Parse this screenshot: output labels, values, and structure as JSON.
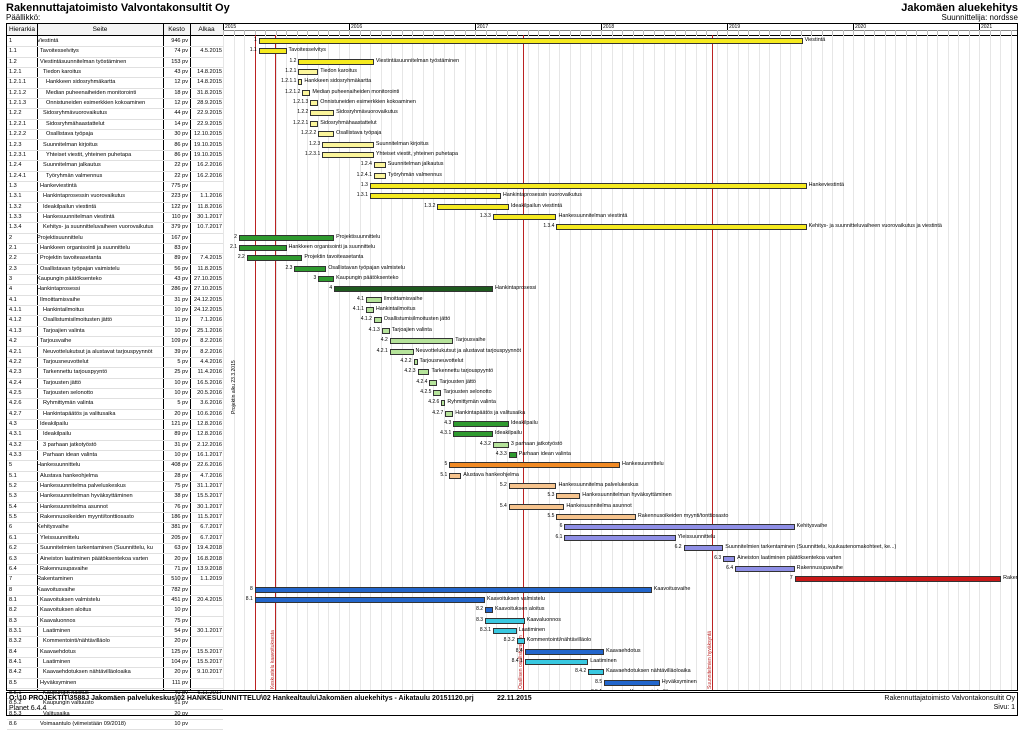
{
  "header": {
    "company": "Rakennuttajatoimisto Valvontakonsultit Oy",
    "manager": "Päällikkö:",
    "project": "Jakomäen aluekehitys",
    "designer": "Suunnittelija: nordsse"
  },
  "columns": {
    "id": "Hierarkia",
    "name": "Seite",
    "duration": "Kesto",
    "start": "Alkaa"
  },
  "timeline": {
    "years": [
      "2015",
      "2016",
      "2017",
      "2018",
      "2019",
      "2020",
      "2021"
    ],
    "milestone_texts": [
      "Projektin alku 23.3.2015",
      "Keskustelu kaavoituksesta",
      "Osallisen osallistuminen",
      "Suunnitelmien hyväksyntä"
    ]
  },
  "colors": {
    "yellow": "#f5ea1f",
    "green": "#2f9a2f",
    "darkgreen": "#1f5a1f",
    "orange": "#f08a24",
    "lightorange": "#f6c48e",
    "purple": "#8f8fe6",
    "red": "#c81818",
    "blue": "#2266cc",
    "cyan": "#38c8e0",
    "lightyellow": "#fbf59a",
    "lightgreen": "#b5e39a"
  },
  "tasks": [
    {
      "id": "1",
      "name": "Viestintä",
      "dur": "946 pv",
      "start": "",
      "bar": [
        0.045,
        0.73
      ],
      "color": "yellow",
      "label": "Viestintä"
    },
    {
      "id": "1.1",
      "name": "Tavoitesselvitys",
      "dur": "74 pv",
      "start": "4.5.2015",
      "bar": [
        0.045,
        0.08
      ],
      "color": "yellow",
      "label": "Tavoitesselvitys"
    },
    {
      "id": "1.2",
      "name": "Viestintäsuunnitelman työstäminen",
      "dur": "153 pv",
      "start": "",
      "bar": [
        0.095,
        0.19
      ],
      "color": "yellow",
      "label": "Viestintäsuunnitelman työstäminen"
    },
    {
      "id": "1.2.1",
      "name": "Tiedon karoitus",
      "dur": "43 pv",
      "start": "14.8.2015",
      "bar": [
        0.095,
        0.12
      ],
      "color": "lightyellow",
      "label": "Tiedon karoitus"
    },
    {
      "id": "1.2.1.1",
      "name": "Hankkeen sidosryhmäkartta",
      "dur": "12 pv",
      "start": "14.8.2015",
      "bar": [
        0.095,
        0.1
      ],
      "color": "lightyellow",
      "label": "Hankkeen sidosryhmäkartta"
    },
    {
      "id": "1.2.1.2",
      "name": "Median puheenaiheiden monitorointi",
      "dur": "18 pv",
      "start": "31.8.2015",
      "bar": [
        0.1,
        0.11
      ],
      "color": "lightyellow",
      "label": "Median puheenaiheiden monitorointi"
    },
    {
      "id": "1.2.1.3",
      "name": "Onnistuneiden esimerkkien kokoaminen",
      "dur": "12 pv",
      "start": "28.9.2015",
      "bar": [
        0.11,
        0.12
      ],
      "color": "lightyellow",
      "label": "Onnistuneiden esimerkkien kokoaminen"
    },
    {
      "id": "1.2.2",
      "name": "Sidosryhmävuorovaikutus",
      "dur": "44 pv",
      "start": "22.9.2015",
      "bar": [
        0.11,
        0.14
      ],
      "color": "lightyellow",
      "label": "Sidosryhmävuorovaikutus"
    },
    {
      "id": "1.2.2.1",
      "name": "Sidosryhmähaastattelut",
      "dur": "14 pv",
      "start": "22.9.2015",
      "bar": [
        0.11,
        0.12
      ],
      "color": "lightyellow",
      "label": "Sidosryhmähaastattelut"
    },
    {
      "id": "1.2.2.2",
      "name": "Osallistava työpaja",
      "dur": "30 pv",
      "start": "12.10.2015",
      "bar": [
        0.12,
        0.14
      ],
      "color": "lightyellow",
      "label": "Osallistava työpaja"
    },
    {
      "id": "1.2.3",
      "name": "Suunnitelman kirjoitus",
      "dur": "86 pv",
      "start": "19.10.2015",
      "bar": [
        0.125,
        0.19
      ],
      "color": "lightyellow",
      "label": "Suunnitelman kirjoitus"
    },
    {
      "id": "1.2.3.1",
      "name": "Yhteiset viestit, yhteinen puhetapa",
      "dur": "86 pv",
      "start": "19.10.2015",
      "bar": [
        0.125,
        0.19
      ],
      "color": "lightyellow",
      "label": "Yhteiset viestit, yhteinen puhetapa"
    },
    {
      "id": "1.2.4",
      "name": "Suunnitelman jalkautus",
      "dur": "22 pv",
      "start": "16.2.2016",
      "bar": [
        0.19,
        0.205
      ],
      "color": "lightyellow",
      "label": "Suunnitelman jalkautus"
    },
    {
      "id": "1.2.4.1",
      "name": "Työryhmän valmennus",
      "dur": "22 pv",
      "start": "16.2.2016",
      "bar": [
        0.19,
        0.205
      ],
      "color": "lightyellow",
      "label": "Työryhmän valmennus"
    },
    {
      "id": "1.3",
      "name": "Hankeviestintä",
      "dur": "775 pv",
      "start": "",
      "bar": [
        0.185,
        0.735
      ],
      "color": "yellow",
      "label": "Hankeviestintä"
    },
    {
      "id": "1.3.1",
      "name": "Hankintaprosessin vuorovaikutus",
      "dur": "223 pv",
      "start": "1.1.2016",
      "bar": [
        0.185,
        0.35
      ],
      "color": "yellow",
      "label": "Hankintaprosessin vuorovaikutus"
    },
    {
      "id": "1.3.2",
      "name": "Ideakilpailun viestintä",
      "dur": "122 pv",
      "start": "11.8.2016",
      "bar": [
        0.27,
        0.36
      ],
      "color": "yellow",
      "label": "Ideakilpailun viestintä"
    },
    {
      "id": "1.3.3",
      "name": "Hankesuunnitelman viestintä",
      "dur": "110 pv",
      "start": "30.1.2017",
      "bar": [
        0.34,
        0.42
      ],
      "color": "yellow",
      "label": "Hankesuunnitelman viestintä"
    },
    {
      "id": "1.3.4",
      "name": "Kehitys- ja suunnitteluvaiheen vuorovaikutus",
      "dur": "379 pv",
      "start": "10.7.2017",
      "bar": [
        0.42,
        0.735
      ],
      "color": "yellow",
      "label": "Kehitys- ja suunnitteluvaiheen vuorovaikutus ja viestintä"
    },
    {
      "id": "2",
      "name": "Projektisuunnittelu",
      "dur": "167 pv",
      "start": "",
      "bar": [
        0.02,
        0.14
      ],
      "color": "green",
      "label": "Projektisuunnittelu"
    },
    {
      "id": "2.1",
      "name": "Hankkeen organisointi ja suunnittelu",
      "dur": "83 pv",
      "start": "",
      "bar": [
        0.02,
        0.08
      ],
      "color": "green",
      "label": "Hankkeen organisointi ja suunnittelu"
    },
    {
      "id": "2.2",
      "name": "Projektin tavoiteasetanta",
      "dur": "89 pv",
      "start": "7.4.2015",
      "bar": [
        0.03,
        0.1
      ],
      "color": "green",
      "label": "Projektin tavoiteasetanta"
    },
    {
      "id": "2.3",
      "name": "Osallistavan työpajan vaimistelu",
      "dur": "56 pv",
      "start": "11.8.2015",
      "bar": [
        0.09,
        0.13
      ],
      "color": "green",
      "label": "Osallistavan työpajan valmistelu"
    },
    {
      "id": "3",
      "name": "Kaupungin päätöksenteko",
      "dur": "43 pv",
      "start": "27.10.2015",
      "bar": [
        0.12,
        0.14
      ],
      "color": "green",
      "label": "Kaupungin päätöksenteko"
    },
    {
      "id": "4",
      "name": "Hankintaprosessi",
      "dur": "286 pv",
      "start": "27.10.2015",
      "bar": [
        0.14,
        0.34
      ],
      "color": "darkgreen",
      "label": "Hankintaprosessi"
    },
    {
      "id": "4.1",
      "name": "Ilmoittamisvaihe",
      "dur": "31 pv",
      "start": "24.12.2015",
      "bar": [
        0.18,
        0.2
      ],
      "color": "lightgreen",
      "label": "Ilmoittamisvaihe"
    },
    {
      "id": "4.1.1",
      "name": "Hankintailmoitus",
      "dur": "10 pv",
      "start": "24.12.2015",
      "bar": [
        0.18,
        0.19
      ],
      "color": "lightgreen",
      "label": "Hankintailmoitus"
    },
    {
      "id": "4.1.2",
      "name": "Osallistumisilmoitusten jättö",
      "dur": "11 pv",
      "start": "7.1.2016",
      "bar": [
        0.19,
        0.2
      ],
      "color": "lightgreen",
      "label": "Osallistumisilmoitusten jättö"
    },
    {
      "id": "4.1.3",
      "name": "Tarjoajien valinta",
      "dur": "10 pv",
      "start": "25.1.2016",
      "bar": [
        0.2,
        0.21
      ],
      "color": "lightgreen",
      "label": "Tarjoajien valinta"
    },
    {
      "id": "4.2",
      "name": "Tarjousvaihe",
      "dur": "109 pv",
      "start": "8.2.2016",
      "bar": [
        0.21,
        0.29
      ],
      "color": "lightgreen",
      "label": "Tarjousvaihe"
    },
    {
      "id": "4.2.1",
      "name": "Neuvottelukutsut ja alustavat tarjouspyynnöt",
      "dur": "39 pv",
      "start": "8.2.2016",
      "bar": [
        0.21,
        0.24
      ],
      "color": "lightgreen",
      "label": "Neuvottelukutsut ja alustavat tarjouspyynnöt"
    },
    {
      "id": "4.2.2",
      "name": "Tarjousneuvottelut",
      "dur": "5 pv",
      "start": "4.4.2016",
      "bar": [
        0.24,
        0.245
      ],
      "color": "lightgreen",
      "label": "Tarjousneuvottelut"
    },
    {
      "id": "4.2.3",
      "name": "Tarkennettu tarjouspyyntö",
      "dur": "25 pv",
      "start": "11.4.2016",
      "bar": [
        0.245,
        0.26
      ],
      "color": "lightgreen",
      "label": "Tarkennettu tarjouspyyntö"
    },
    {
      "id": "4.2.4",
      "name": "Tarjousten jättö",
      "dur": "10 pv",
      "start": "16.5.2016",
      "bar": [
        0.26,
        0.27
      ],
      "color": "lightgreen",
      "label": "Tarjousten jättö"
    },
    {
      "id": "4.2.5",
      "name": "Tarjousten selonotto",
      "dur": "10 pv",
      "start": "20.5.2016",
      "bar": [
        0.265,
        0.275
      ],
      "color": "lightgreen",
      "label": "Tarjousten selonotto"
    },
    {
      "id": "4.2.6",
      "name": "Ryhmittymän valinta",
      "dur": "5 pv",
      "start": "3.6.2016",
      "bar": [
        0.275,
        0.28
      ],
      "color": "lightgreen",
      "label": "Ryhmittymän valinta"
    },
    {
      "id": "4.2.7",
      "name": "Hankintapäätös ja valitusaika",
      "dur": "20 pv",
      "start": "10.6.2016",
      "bar": [
        0.28,
        0.29
      ],
      "color": "lightgreen",
      "label": "Hankintapäätös ja valitusaika"
    },
    {
      "id": "4.3",
      "name": "Ideakilpailu",
      "dur": "121 pv",
      "start": "12.8.2016",
      "bar": [
        0.29,
        0.36
      ],
      "color": "green",
      "label": "Ideakilpailu"
    },
    {
      "id": "4.3.1",
      "name": "Ideakilpailu",
      "dur": "89 pv",
      "start": "12.8.2016",
      "bar": [
        0.29,
        0.34
      ],
      "color": "green",
      "label": "Ideakilpailu"
    },
    {
      "id": "4.3.2",
      "name": "3 parhaan jatkotyöstö",
      "dur": "31 pv",
      "start": "2.12.2016",
      "bar": [
        0.34,
        0.36
      ],
      "color": "lightgreen",
      "label": "3 parhaan jatkotyöstö"
    },
    {
      "id": "4.3.3",
      "name": "Parhaan idean valinta",
      "dur": "10 pv",
      "start": "16.1.2017",
      "bar": [
        0.36,
        0.37
      ],
      "color": "green",
      "label": "Parhaan idean valinta"
    },
    {
      "id": "5",
      "name": "Hankesuunnittelu",
      "dur": "408 pv",
      "start": "22.6.2016",
      "bar": [
        0.285,
        0.5
      ],
      "color": "orange",
      "label": "Hankesuunnittelu"
    },
    {
      "id": "5.1",
      "name": "Alustava hankeohjelma",
      "dur": "28 pv",
      "start": "4.7.2016",
      "bar": [
        0.285,
        0.3
      ],
      "color": "lightorange",
      "label": "Alustava hankeohjelma"
    },
    {
      "id": "5.2",
      "name": "Hankesuunnitelma palveluskeskus",
      "dur": "75 pv",
      "start": "31.1.2017",
      "bar": [
        0.36,
        0.42
      ],
      "color": "lightorange",
      "label": "Hankesuunnitelma palvelukeskus"
    },
    {
      "id": "5.3",
      "name": "Hankesuunnitelman hyväksyttäminen",
      "dur": "38 pv",
      "start": "15.5.2017",
      "bar": [
        0.42,
        0.45
      ],
      "color": "lightorange",
      "label": "Hankesuunnitelman hyväksyttäminen"
    },
    {
      "id": "5.4",
      "name": "Hankesuunnitelma asunnot",
      "dur": "76 pv",
      "start": "30.1.2017",
      "bar": [
        0.36,
        0.43
      ],
      "color": "lightorange",
      "label": "Hankesuunnitelma asunnot"
    },
    {
      "id": "5.5",
      "name": "Rakennusoikeiden myynti/tonttiosasto",
      "dur": "186 pv",
      "start": "11.5.2017",
      "bar": [
        0.42,
        0.52
      ],
      "color": "lightorange",
      "label": "Rakennusoikeiden myynti/tonttiosasto"
    },
    {
      "id": "6",
      "name": "Kehitysvaihe",
      "dur": "381 pv",
      "start": "6.7.2017",
      "bar": [
        0.43,
        0.72
      ],
      "color": "purple",
      "label": "Kehitysvaihe"
    },
    {
      "id": "6.1",
      "name": "Yleissuunnittelu",
      "dur": "205 pv",
      "start": "6.7.2017",
      "bar": [
        0.43,
        0.57
      ],
      "color": "purple",
      "label": "Yleissuunnittelu"
    },
    {
      "id": "6.2",
      "name": "Suunnitelmien tarkentaminen (Suunnittelu, ku",
      "dur": "63 pv",
      "start": "19.4.2018",
      "bar": [
        0.58,
        0.63
      ],
      "color": "purple",
      "label": "Suunnitelmien tarkentaminen (Suunnittelu, kuukautenomakohteet, ke...)"
    },
    {
      "id": "6.3",
      "name": "Aineiston laatiminen päätöksentekoa varten",
      "dur": "20 pv",
      "start": "16.8.2018",
      "bar": [
        0.63,
        0.645
      ],
      "color": "purple",
      "label": "Aineiston laatiminen päätöksentekoa varten"
    },
    {
      "id": "6.4",
      "name": "Rakennusupavaihe",
      "dur": "71 pv",
      "start": "13.9.2018",
      "bar": [
        0.645,
        0.72
      ],
      "color": "purple",
      "label": "Rakennusupavaihe"
    },
    {
      "id": "7",
      "name": "Rakentaminen",
      "dur": "510 pv",
      "start": "1.1.2019",
      "bar": [
        0.72,
        0.98
      ],
      "color": "red",
      "label": "Rakentaminen"
    },
    {
      "id": "8",
      "name": "Kaavoitusvaihe",
      "dur": "782 pv",
      "start": "",
      "bar": [
        0.04,
        0.54
      ],
      "color": "blue",
      "label": "Kaavoitusvaihe"
    },
    {
      "id": "8.1",
      "name": "Kaavoituksen valmistelu",
      "dur": "451 pv",
      "start": "20.4.2015",
      "bar": [
        0.04,
        0.33
      ],
      "color": "blue",
      "label": "Kaavoituksen valmistelu"
    },
    {
      "id": "8.2",
      "name": "Kaavoituksen aloitus",
      "dur": "10 pv",
      "start": "",
      "bar": [
        0.33,
        0.34
      ],
      "color": "blue",
      "label": "Kaavoituksen aloitus"
    },
    {
      "id": "8.3",
      "name": "Kaavaluonnos",
      "dur": "75 pv",
      "start": "",
      "bar": [
        0.33,
        0.38
      ],
      "color": "cyan",
      "label": "Kaavaluonnos"
    },
    {
      "id": "8.3.1",
      "name": "Laatiminen",
      "dur": "54 pv",
      "start": "30.1.2017",
      "bar": [
        0.34,
        0.37
      ],
      "color": "cyan",
      "label": "Laatiminen"
    },
    {
      "id": "8.3.2",
      "name": "Kommentointi/nähtävilläolo",
      "dur": "20 pv",
      "start": "",
      "bar": [
        0.37,
        0.38
      ],
      "color": "cyan",
      "label": "Kommentointi/nähtävilläolo"
    },
    {
      "id": "8.4",
      "name": "Kaavaehdotus",
      "dur": "125 pv",
      "start": "15.5.2017",
      "bar": [
        0.38,
        0.48
      ],
      "color": "blue",
      "label": "Kaavaehdotus"
    },
    {
      "id": "8.4.1",
      "name": "Laatiminen",
      "dur": "104 pv",
      "start": "15.5.2017",
      "bar": [
        0.38,
        0.46
      ],
      "color": "cyan",
      "label": "Laatiminen"
    },
    {
      "id": "8.4.2",
      "name": "Kaavaehdotuksen nähtävilläoloaika",
      "dur": "20 pv",
      "start": "9.10.2017",
      "bar": [
        0.46,
        0.48
      ],
      "color": "cyan",
      "label": "Kaavaehdotuksen nähtävilläoloaika"
    },
    {
      "id": "8.5",
      "name": "Hyväksyminen",
      "dur": "111 pv",
      "start": "",
      "bar": [
        0.48,
        0.55
      ],
      "color": "blue",
      "label": "Hyväksyminen"
    },
    {
      "id": "8.5.1",
      "name": "Kaupungin hallitus",
      "dur": "40 pv",
      "start": "6.11.2017",
      "bar": [
        0.48,
        0.51
      ],
      "color": "cyan",
      "label": "Kaupungin hallitus"
    },
    {
      "id": "8.5.2",
      "name": "Kaupungin valtuusto",
      "dur": "51 pv",
      "start": "",
      "bar": [
        0.51,
        0.545
      ],
      "color": "cyan",
      "label": "Kaupungin valtuusto"
    },
    {
      "id": "8.5.3",
      "name": "Valitusaika",
      "dur": "20 pv",
      "start": "",
      "bar": [
        0.545,
        0.56
      ],
      "color": "cyan",
      "label": "Valitusaika"
    },
    {
      "id": "8.6",
      "name": "Voimaantulo (viimeistään 09/2018)",
      "dur": "10 pv",
      "start": "",
      "bar": [
        0.56,
        0.57
      ],
      "color": "blue",
      "label": "Voimaantulo (viimeistään 09/2018)"
    }
  ],
  "footer": {
    "path": "O:\\10 PROJEKTIT\\3588J Jakomäen palvelukeskus\\02 HANKESUUNNITTELU\\02 Hankealtaulu\\Jakomäen aluekehitys - Aikataulu 20151120.prj",
    "date": "22.11.2015",
    "company": "Rakennuttajatoimisto Valvontakonsultit Oy",
    "page": "Sivu: 1",
    "planet": "Planet 6.4.4"
  }
}
